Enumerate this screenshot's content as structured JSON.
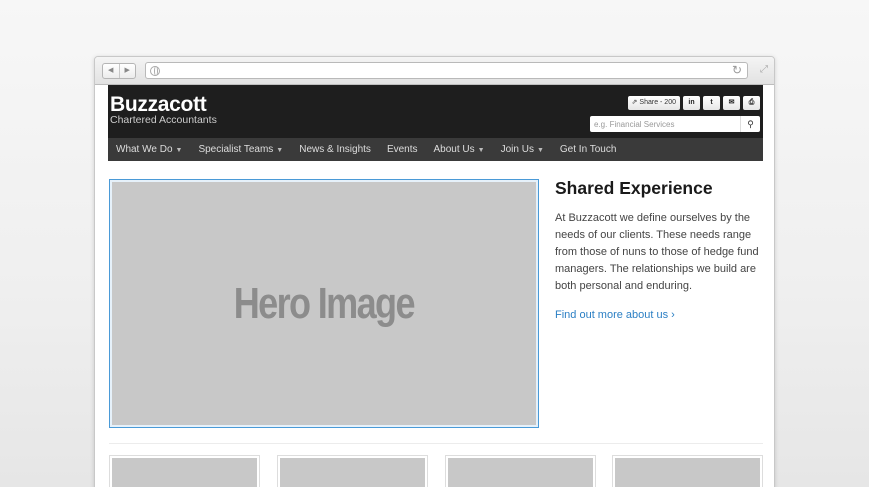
{
  "browser": {
    "url": "",
    "back_icon": "triangle-left",
    "forward_icon": "triangle-right",
    "reload_icon": "reload"
  },
  "header": {
    "brand": "Buzzacott",
    "tagline": "Chartered Accountants",
    "share_label": "Share - 200",
    "social": {
      "linkedin": "in",
      "twitter": "t",
      "email": "✉",
      "print": "⎙"
    },
    "search_placeholder": "e.g. Financial Services"
  },
  "nav": {
    "items": [
      {
        "label": "What We Do",
        "dropdown": true
      },
      {
        "label": "Specialist Teams",
        "dropdown": true
      },
      {
        "label": "News & Insights",
        "dropdown": false
      },
      {
        "label": "Events",
        "dropdown": false
      },
      {
        "label": "About Us",
        "dropdown": true
      },
      {
        "label": "Join Us",
        "dropdown": true
      },
      {
        "label": "Get In Touch",
        "dropdown": false
      }
    ]
  },
  "hero": {
    "placeholder_text": "Hero Image"
  },
  "intro": {
    "title": "Shared Experience",
    "body": "At Buzzacott we define ourselves by the needs of our clients. These needs range from those of nuns to those of hedge fund managers. The relationships we build are both personal and enduring.",
    "link": "Find out more about us ›"
  },
  "colors": {
    "header_bg": "#1e1e1e",
    "nav_bg": "#3a3a3a",
    "link": "#2b7fc4",
    "placeholder": "#c8c8c8"
  }
}
